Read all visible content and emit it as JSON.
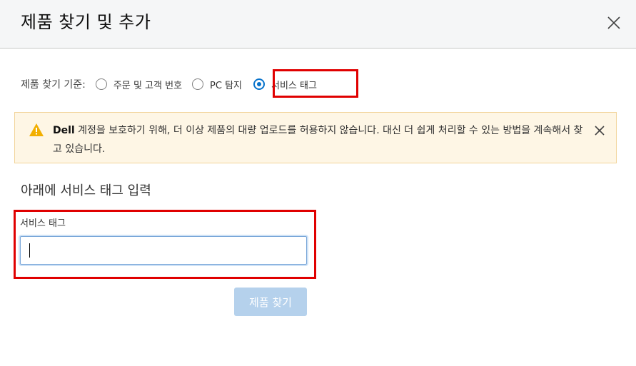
{
  "dialog": {
    "title": "제품 찾기 및 추가",
    "close_icon": "close-icon"
  },
  "criteria": {
    "label": "제품 찾기 기준:",
    "options": [
      {
        "label": "주문 및 고객 번호",
        "checked": false
      },
      {
        "label": "PC 탐지",
        "checked": false
      },
      {
        "label": "서비스 태그",
        "checked": true
      }
    ]
  },
  "alert": {
    "icon": "warning-icon",
    "brand": "Dell",
    "message": " 계정을 보호하기 위해, 더 이상 제품의 대량 업로드를 허용하지 않습니다. 대신 더 쉽게 처리할 수 있는 방법을 계속해서 찾고 있습니다.",
    "close_icon": "close-icon",
    "colors": {
      "background": "#fef6e5",
      "border": "#f2d49a",
      "icon": "#f2af00"
    }
  },
  "section": {
    "title": "아래에 서비스 태그 입력"
  },
  "service_tag_field": {
    "label": "서비스 태그",
    "value": "",
    "placeholder": ""
  },
  "actions": {
    "find_label": "제품 찾기",
    "find_enabled": false
  },
  "colors": {
    "accent": "#0672cb",
    "highlight_border": "#e00000",
    "disabled_button": "#b5d1ec"
  }
}
